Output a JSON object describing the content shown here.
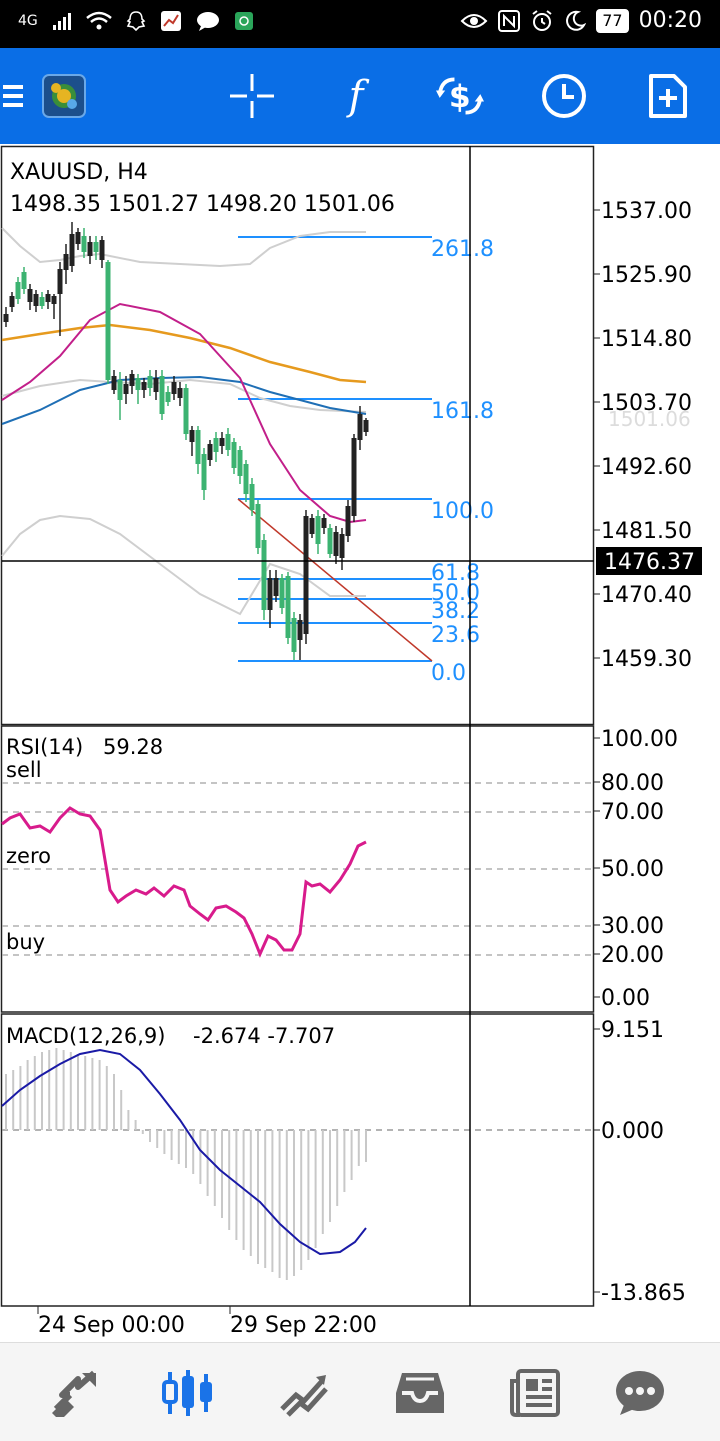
{
  "status_bar": {
    "network": "4G",
    "battery": "77",
    "time": "00:20"
  },
  "toolbar": {
    "buttons": [
      "menu-icon",
      "app-logo",
      "crosshair-icon",
      "indicators-icon",
      "trade-icon",
      "timeframe-icon",
      "new-order-icon"
    ],
    "indicator_label": "f"
  },
  "chart": {
    "symbol": "XAUUSD, H4",
    "ohlc": "1498.35 1501.27 1498.20 1501.06",
    "price_axis": [
      "1537.00",
      "1525.90",
      "1514.80",
      "1503.70",
      "1492.60",
      "1481.50",
      "1470.40",
      "1459.30"
    ],
    "current_price": "1476.37",
    "last_price_ghost": "1501.06",
    "fib_levels": [
      "261.8",
      "161.8",
      "100.0",
      "61.8",
      "50.0",
      "38.2",
      "23.6",
      "0.0"
    ]
  },
  "rsi": {
    "title": "RSI(14)",
    "value": "59.28",
    "labels": {
      "sell": "sell",
      "zero": "zero",
      "buy": "buy"
    },
    "axis": [
      "100.00",
      "80.00",
      "70.00",
      "50.00",
      "30.00",
      "20.00",
      "0.00"
    ]
  },
  "macd": {
    "title": "MACD(12,26,9)",
    "values": "-2.674 -7.707",
    "axis": [
      "9.151",
      "0.000",
      "-13.865"
    ]
  },
  "time_axis": [
    "24 Sep 00:00",
    "29 Sep 22:00"
  ],
  "bottom_nav": [
    "quotes",
    "chart",
    "trade",
    "history",
    "news",
    "chat"
  ],
  "colors": {
    "toolbar": "#0a6ee6",
    "bull": "#3cb371",
    "bear": "#222222",
    "fib": "#1e90ff",
    "ma_orange": "#e69a1e",
    "ma_blue": "#1f6fb5",
    "ma_magenta": "#c21f8a",
    "rsi_line": "#d81b8c",
    "macd_signal": "#1a1aa6",
    "nav_active": "#1a73e8"
  }
}
